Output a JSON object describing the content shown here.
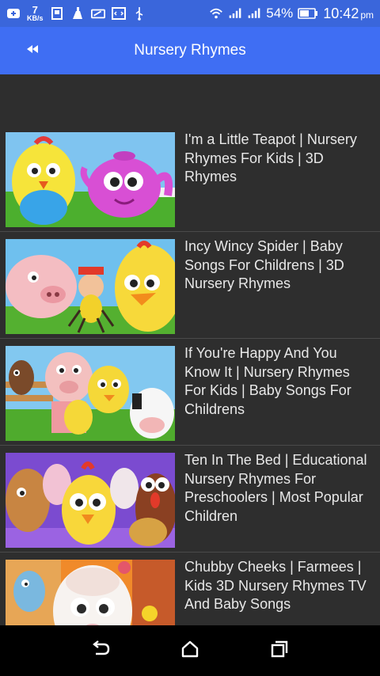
{
  "status_bar": {
    "speed_value": "7",
    "speed_unit": "KB/s",
    "battery_percent": "54%",
    "time": "10:42",
    "time_suffix": "pm",
    "icons": [
      "plus-icon",
      "sim-card-icon",
      "cleaner-icon",
      "card-icon",
      "code-icon",
      "usb-icon",
      "wifi-icon",
      "signal-icon",
      "signal-icon",
      "battery-icon"
    ]
  },
  "app_bar": {
    "title": "Nursery Rhymes",
    "back_icon": "rewind-back-icon",
    "color": "#3f6ef3"
  },
  "videos": [
    {
      "title": "I'm a Little Teapot | Nursery Rhymes For Kids | 3D Rhymes"
    },
    {
      "title": "Incy Wincy Spider | Baby Songs For Childrens | 3D Nursery Rhymes"
    },
    {
      "title": "If You're Happy And You Know It | Nursery Rhymes For Kids | Baby Songs For Childrens"
    },
    {
      "title": "Ten In The Bed | Educational Nursery Rhymes For Preschoolers | Most Popular Children"
    },
    {
      "title": "Chubby Cheeks | Farmees | Kids 3D Nursery Rhymes TV And Baby Songs"
    }
  ],
  "nav_bar": {
    "icons": [
      "back-icon",
      "home-icon",
      "recents-icon"
    ]
  }
}
